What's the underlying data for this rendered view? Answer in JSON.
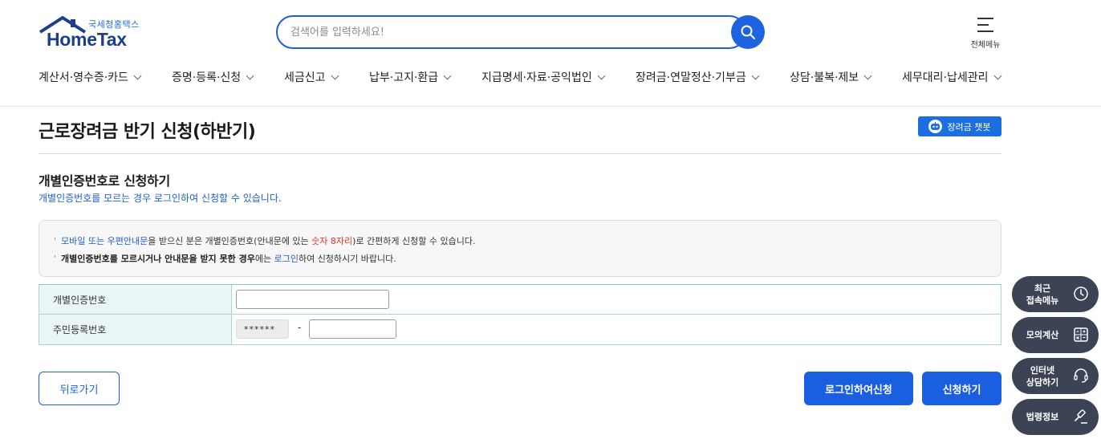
{
  "header": {
    "logo_sub": "국세청홈택스",
    "logo_main": "HomeTax",
    "search_placeholder": "검색어를 입력하세요!",
    "allmenu_label": "전체메뉴"
  },
  "gnb": {
    "items": [
      {
        "label": "계산서·영수증·카드"
      },
      {
        "label": "증명·등록·신청"
      },
      {
        "label": "세금신고"
      },
      {
        "label": "납부·고지·환급"
      },
      {
        "label": "지급명세·자료·공익법인"
      },
      {
        "label": "장려금·연말정산·기부금"
      },
      {
        "label": "상담·불복·제보"
      },
      {
        "label": "세무대리·납세관리"
      }
    ]
  },
  "page": {
    "title": "근로장려금 반기 신청(하반기)",
    "chatbot_label": "장려금 챗봇",
    "section_title": "개별인증번호로 신청하기",
    "section_desc": "개별인증번호를 모르는 경우 로그인하여 신청할 수 있습니다."
  },
  "notice": {
    "line1": {
      "part1": "모바일 또는 우편안내문",
      "part2": "을 받으신 분은 개별인증번호(안내문에 있는 ",
      "part3": "숫자 8자리",
      "part4": ")로 간편하게 신청할 수 있습니다."
    },
    "line2": {
      "part1": "개별인증번호를 모르시거나 안내문을 받지 못한 경우",
      "part2": "에는 ",
      "part3": "로그인",
      "part4": "하여 신청하시기 바랍니다."
    }
  },
  "form": {
    "cert_label": "개별인증번호",
    "cert_value": "",
    "rrn_label": "주민등록번호",
    "rrn_front_masked": "******",
    "rrn_dash": "-",
    "rrn_back_value": ""
  },
  "buttons": {
    "back": "뒤로가기",
    "login_apply": "로그인하여신청",
    "apply": "신청하기"
  },
  "quick_menu": {
    "recent_line1": "최근",
    "recent_line2": "접속메뉴",
    "mock_calc": "모의계산",
    "consult_line1": "인터넷",
    "consult_line2": "상담하기",
    "law": "법령정보"
  },
  "colors": {
    "primary": "#1a5fe0",
    "link_blue": "#1f5fcf",
    "highlight_red": "#d9342b",
    "quick_menu_bg": "#3b4354",
    "table_header_bg": "#eaf5f5"
  }
}
